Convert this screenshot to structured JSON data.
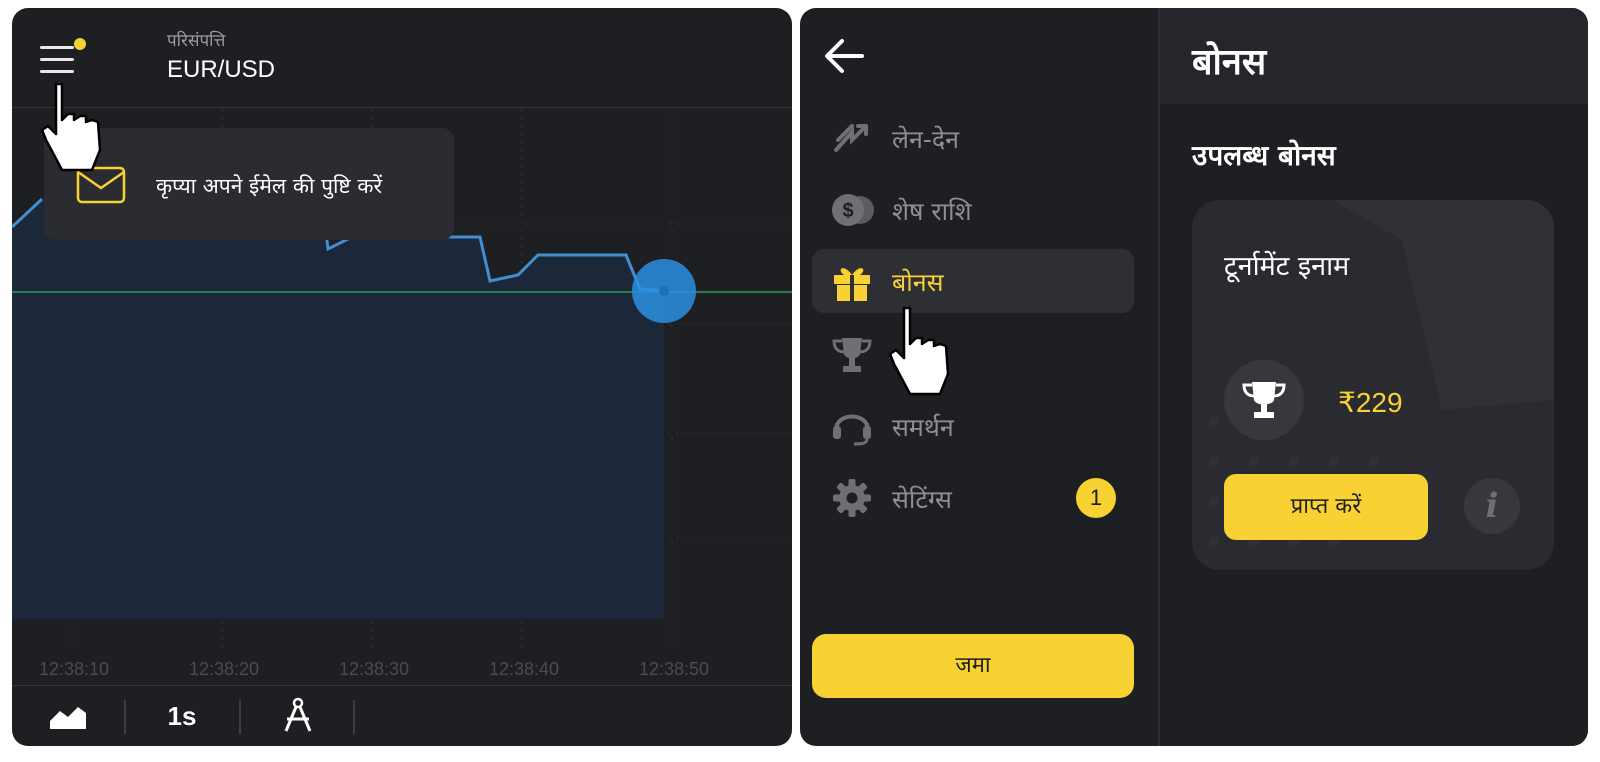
{
  "left_panel": {
    "asset_label": "परिसंपत्ति",
    "asset_name": "EUR/USD",
    "toast_message": "कृप्या अपने ईमेल की पुष्टि करें",
    "timeframe": "1s",
    "menu_icon": "hamburger-icon",
    "toolbar_icons": [
      "area-chart-icon",
      "compass-drawing-icon"
    ]
  },
  "chart_data": {
    "type": "line",
    "x": [
      "12:38:10",
      "12:38:20",
      "12:38:30",
      "12:38:40",
      "12:38:50"
    ],
    "colors": {
      "line": "#3f8fd2",
      "current_level": "#1e9e5a",
      "marker": "#2a8fe0"
    }
  },
  "right_panel": {
    "menu": [
      {
        "label": "लेन-देन",
        "icon": "transactions-icon"
      },
      {
        "label": "शेष राशि",
        "icon": "balance-coins-icon"
      },
      {
        "label": "बोनस",
        "icon": "gift-icon",
        "active": true
      },
      {
        "label": "",
        "icon": "trophy-icon"
      },
      {
        "label": "समर्थन",
        "icon": "headset-icon"
      },
      {
        "label": "सेटिंग्स",
        "icon": "gear-icon",
        "badge": "1"
      }
    ],
    "deposit_label": "जमा",
    "content_title": "बोनस",
    "section_title": "उपलब्ध बोनस",
    "card": {
      "title": "टूर्नामेंट इनाम",
      "amount": "₹229",
      "claim_label": "प्राप्त करें",
      "info_symbol": "i"
    },
    "accent_color": "#f7d232"
  }
}
